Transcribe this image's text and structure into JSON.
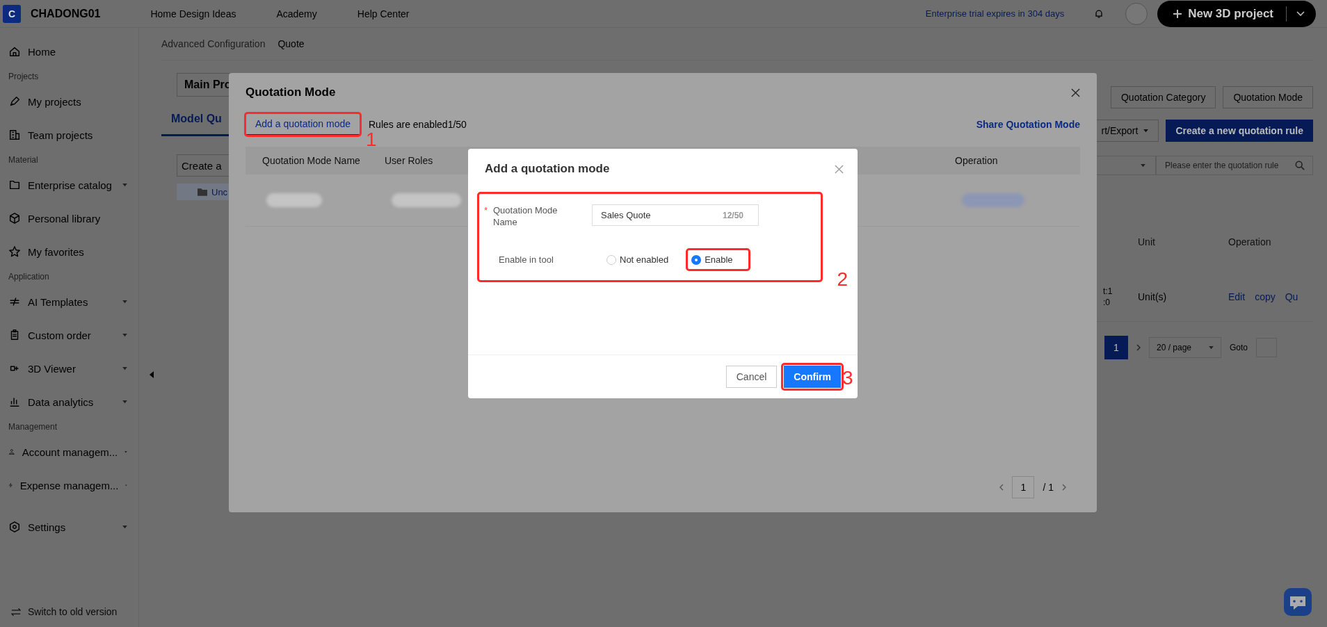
{
  "top_bar": {
    "logo_letter": "C",
    "org_name": "CHADONG01",
    "nav": [
      "Home Design Ideas",
      "Academy",
      "Help Center"
    ],
    "trial_notice": "Enterprise trial expires in 304 days",
    "new_project_button": "New 3D project"
  },
  "sidebar": {
    "groups": [
      {
        "items": [
          {
            "label": "Home",
            "has_submenu": false
          }
        ]
      },
      {
        "heading": "Projects",
        "items": [
          {
            "label": "My projects",
            "has_submenu": false
          },
          {
            "label": "Team projects",
            "has_submenu": false
          }
        ]
      },
      {
        "heading": "Material",
        "items": [
          {
            "label": "Enterprise catalog",
            "has_submenu": true
          },
          {
            "label": "Personal library",
            "has_submenu": false
          },
          {
            "label": "My favorites",
            "has_submenu": false
          }
        ]
      },
      {
        "heading": "Application",
        "items": [
          {
            "label": "AI Templates",
            "has_submenu": true
          },
          {
            "label": "Custom order",
            "has_submenu": true
          },
          {
            "label": "3D Viewer",
            "has_submenu": true
          },
          {
            "label": "Data analytics",
            "has_submenu": true
          }
        ]
      },
      {
        "heading": "Management",
        "items": [
          {
            "label": "Account managem...",
            "has_submenu": true
          },
          {
            "label": "Expense managem...",
            "has_submenu": true
          }
        ]
      },
      {
        "items": [
          {
            "label": "Settings",
            "has_submenu": true
          }
        ]
      }
    ],
    "footer_link": "Switch to old version"
  },
  "breadcrumb": [
    "Advanced Configuration",
    "Quote"
  ],
  "page": {
    "project_title": "Main Pro",
    "tabs": [
      {
        "label": "Model Qu",
        "selected": true
      }
    ],
    "create_button": "Create a",
    "folder_item": "Unc",
    "header_buttons": [
      "Quotation Category",
      "Quotation Mode"
    ],
    "import_export_button": "rt/Export",
    "create_rule_button": "Create a new quotation rule",
    "search": {
      "placeholder": "Please enter the quotation rule"
    },
    "table": {
      "columns": [
        "Unit",
        "Operation"
      ],
      "rows": [
        {
          "cut_lines": [
            "t:1",
            ":0"
          ],
          "unit": "Unit(s)",
          "actions": [
            "Edit",
            "copy",
            "Qu"
          ]
        }
      ]
    },
    "pagination": {
      "pages": [
        {
          "label": "1",
          "selected": true
        }
      ],
      "page_size": "20 / page",
      "goto_label": "Goto"
    }
  },
  "quotation_mode_dialog": {
    "title": "Quotation Mode",
    "add_button": {
      "label": "Add a quotation mode",
      "callout": "1"
    },
    "rules_count": "Rules are enabled1/50",
    "share_link": "Share Quotation Mode",
    "table": {
      "columns": [
        "Quotation Mode Name",
        "User Roles",
        "Operation"
      ]
    },
    "pagination": {
      "current": "1",
      "total": "/ 1"
    }
  },
  "add_dialog": {
    "title": "Add a quotation mode",
    "callout": "2",
    "fields": [
      {
        "kind": "text",
        "label": "Quotation Mode Name",
        "required_mark": "*",
        "value": "Sales Quote",
        "counter": "12/50"
      },
      {
        "kind": "radio",
        "label": "Enable in tool",
        "options": [
          {
            "label": "Not enabled",
            "selected": false,
            "highlighted": false
          },
          {
            "label": "Enable",
            "selected": true,
            "highlighted": true
          }
        ]
      }
    ],
    "buttons": [
      {
        "label": "Cancel",
        "kind": "secondary"
      },
      {
        "label": "Confirm",
        "kind": "primary",
        "callout": "3"
      }
    ]
  }
}
